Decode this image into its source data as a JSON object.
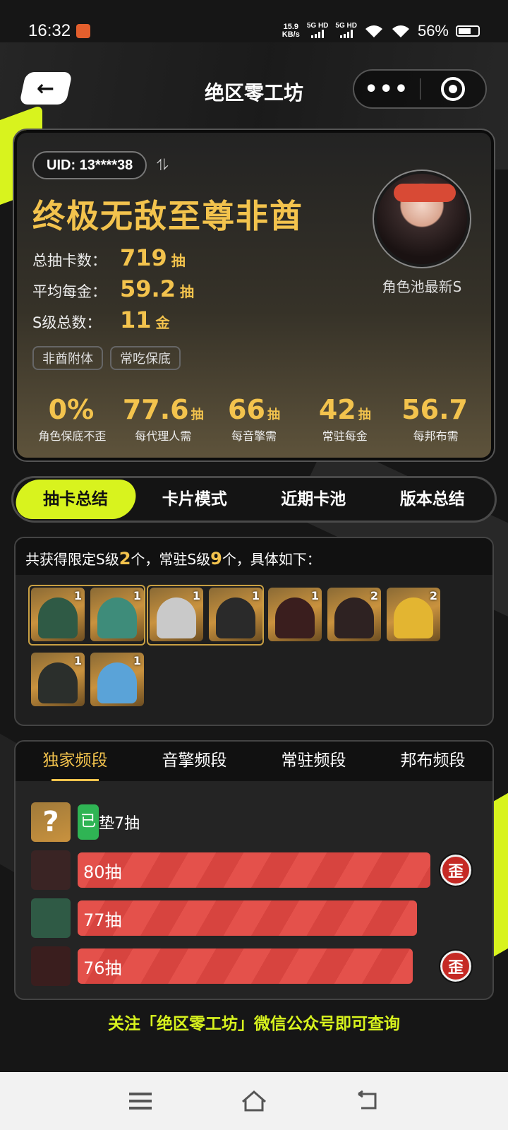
{
  "status_bar": {
    "time": "16:32",
    "net_speed_value": "15.9",
    "net_speed_unit": "KB/s",
    "sim1": "5G HD",
    "sim2": "5G HD",
    "battery": "56%"
  },
  "header": {
    "title": "绝区零工坊",
    "back_icon": "arrow-left-icon",
    "more_icon": "more-dots-icon",
    "close_icon": "target-close-icon"
  },
  "profile": {
    "uid": "UID: 13****38",
    "switch_icon": "⥮",
    "nickname": "终极无敌至尊非酋",
    "stats": [
      {
        "label": "总抽卡数：",
        "value": "719",
        "unit": "抽"
      },
      {
        "label": "平均每金：",
        "value": "59.2",
        "unit": "抽"
      },
      {
        "label": "S级总数：",
        "value": "11",
        "unit": "金"
      }
    ],
    "tags": [
      "非酋附体",
      "常吃保底"
    ],
    "avatar_caption": "角色池最新S",
    "metrics": [
      {
        "value": "0%",
        "unit": "",
        "label": "角色保底不歪"
      },
      {
        "value": "77.6",
        "unit": "抽",
        "label": "每代理人需"
      },
      {
        "value": "66",
        "unit": "抽",
        "label": "每音擎需"
      },
      {
        "value": "42",
        "unit": "抽",
        "label": "常驻每金"
      },
      {
        "value": "56.7",
        "unit": "",
        "label": "每邦布需"
      }
    ]
  },
  "tabs": [
    "抽卡总结",
    "卡片模式",
    "近期卡池",
    "版本总结"
  ],
  "srank": {
    "prefix": "共获得限定S级",
    "limited": "2",
    "mid": "个，常驻S级",
    "standard": "9",
    "suffix": "个，具体如下：",
    "cards": [
      {
        "name": "green-hair-agent",
        "count": "1",
        "color": "#2f5a45"
      },
      {
        "name": "frog-wengine",
        "count": "1",
        "color": "#3e8c7a"
      },
      {
        "name": "white-hair-agent",
        "count": "1",
        "color": "#c9c9c9"
      },
      {
        "name": "black-ball-wengine",
        "count": "1",
        "color": "#2a2a2a"
      },
      {
        "name": "red-eye-agent",
        "count": "1",
        "color": "#3a1e1e"
      },
      {
        "name": "goggle-agent",
        "count": "2",
        "color": "#2e2222"
      },
      {
        "name": "yellow-bangboo",
        "count": "2",
        "color": "#e3b531"
      },
      {
        "name": "dark-bangboo",
        "count": "1",
        "color": "#2b2f2c"
      },
      {
        "name": "blue-bangboo",
        "count": "1",
        "color": "#5aa3d8"
      }
    ]
  },
  "pity": {
    "tabs": [
      "独家频段",
      "音擎频段",
      "常驻频段",
      "邦布频段"
    ],
    "pending": {
      "badge": "已",
      "text": "垫7抽",
      "icon": "?"
    },
    "rows": [
      {
        "label": "80抽",
        "value": 80,
        "lost": true,
        "avatar_color": "#3a2424"
      },
      {
        "label": "77抽",
        "value": 77,
        "lost": false,
        "avatar_color": "#2f5a45"
      },
      {
        "label": "76抽",
        "value": 76,
        "lost": true,
        "avatar_color": "#3a1e1e"
      }
    ],
    "lost_label": "歪"
  },
  "footer_note": "关注「绝区零工坊」微信公众号即可查询"
}
